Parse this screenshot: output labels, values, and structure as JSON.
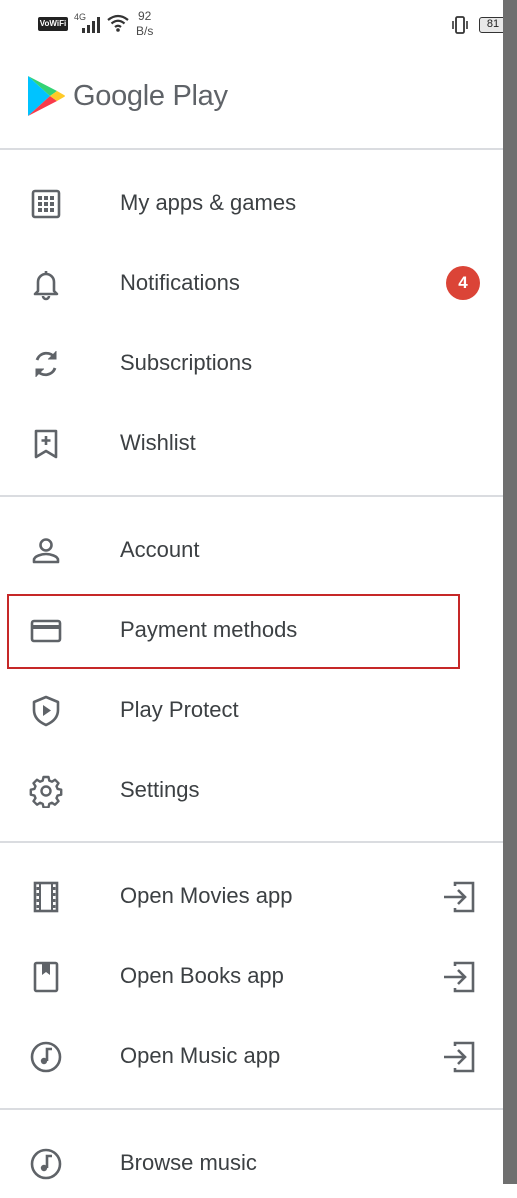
{
  "status_bar": {
    "vowifi": "VoWiFi",
    "network": "4G",
    "network_sub": "↑↓",
    "speed_value": "92",
    "speed_unit": "B/s",
    "battery": "81"
  },
  "header": {
    "brand": "Google Play",
    "logo_icon": "google-play-logo-icon"
  },
  "sections": {
    "library": [
      {
        "label": "My apps & games",
        "icon": "apps-grid-icon"
      },
      {
        "label": "Notifications",
        "icon": "bell-icon",
        "badge": "4"
      },
      {
        "label": "Subscriptions",
        "icon": "refresh-icon"
      },
      {
        "label": "Wishlist",
        "icon": "bookmark-add-icon"
      }
    ],
    "account": [
      {
        "label": "Account",
        "icon": "person-icon"
      },
      {
        "label": "Payment methods",
        "icon": "credit-card-icon",
        "highlighted": true
      },
      {
        "label": "Play Protect",
        "icon": "shield-play-icon"
      },
      {
        "label": "Settings",
        "icon": "gear-icon"
      }
    ],
    "apps": [
      {
        "label": "Open Movies app",
        "icon": "film-icon",
        "trail_icon": "open-app-icon"
      },
      {
        "label": "Open Books app",
        "icon": "book-icon",
        "trail_icon": "open-app-icon"
      },
      {
        "label": "Open Music app",
        "icon": "music-note-icon",
        "trail_icon": "open-app-icon"
      }
    ],
    "more": [
      {
        "label": "Browse music",
        "icon": "music-note-icon"
      }
    ]
  },
  "colors": {
    "icon": "#5f6368",
    "text": "#3c4043",
    "badge": "#db4437",
    "highlight_border": "#c62828",
    "divider": "#dadce0"
  }
}
